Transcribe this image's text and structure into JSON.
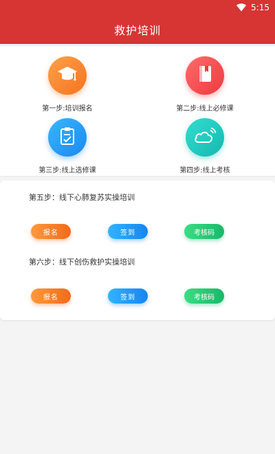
{
  "status_bar": {
    "time": "5:15",
    "wifi_icon": "wifi-icon"
  },
  "app_bar": {
    "title": "救护培训"
  },
  "steps": [
    {
      "label": "第一步:培训报名",
      "icon": "graduation-cap-icon",
      "color": "#f5731f"
    },
    {
      "label": "第二步:线上必修课",
      "icon": "book-icon",
      "color": "#ee3a3f"
    },
    {
      "label": "第三步:线上选修课",
      "icon": "clipboard-check-icon",
      "color": "#1b88f0"
    },
    {
      "label": "第四步:线上考核",
      "icon": "cloud-icon",
      "color": "#14b9b0"
    }
  ],
  "trainings": [
    {
      "title": "第五步：线下心肺复苏实操培训",
      "signup_label": "报名",
      "checkin_label": "签到",
      "code_label": "考核码"
    },
    {
      "title": "第六步：线下创伤救护实操培训",
      "signup_label": "报名",
      "checkin_label": "签到",
      "code_label": "考核码"
    }
  ],
  "colors": {
    "primary": "#d63534",
    "orange": "#f26a1b",
    "blue": "#1585ef",
    "green": "#17b86a"
  }
}
